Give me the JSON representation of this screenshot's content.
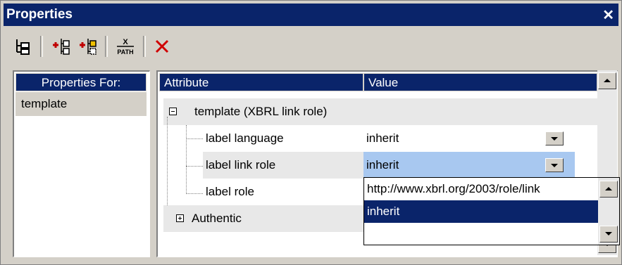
{
  "window": {
    "title": "Properties",
    "close_label": "✕"
  },
  "toolbar": {
    "items": [
      {
        "name": "tree-view-icon"
      },
      {
        "name": "add-element-before-icon"
      },
      {
        "name": "add-element-after-icon"
      },
      {
        "name": "xpath-icon",
        "label": "X",
        "sublabel": "PATH"
      },
      {
        "name": "delete-icon"
      }
    ]
  },
  "left_pane": {
    "header": "Properties For:",
    "items": [
      "template"
    ]
  },
  "grid": {
    "headers": {
      "attribute": "Attribute",
      "value": "Value"
    },
    "group": "template (XBRL link role)",
    "rows": [
      {
        "attribute": "label language",
        "value": "inherit"
      },
      {
        "attribute": "label link role",
        "value": "inherit"
      },
      {
        "attribute": "label role",
        "value": ""
      }
    ],
    "collapsed_group": "Authentic"
  },
  "dropdown": {
    "options": [
      "http://www.xbrl.org/2003/role/link",
      "inherit"
    ],
    "selected": "inherit"
  },
  "colors": {
    "header_bg": "#0a246a",
    "selected_row": "#a8c8f0",
    "chrome": "#d4d0c8"
  }
}
